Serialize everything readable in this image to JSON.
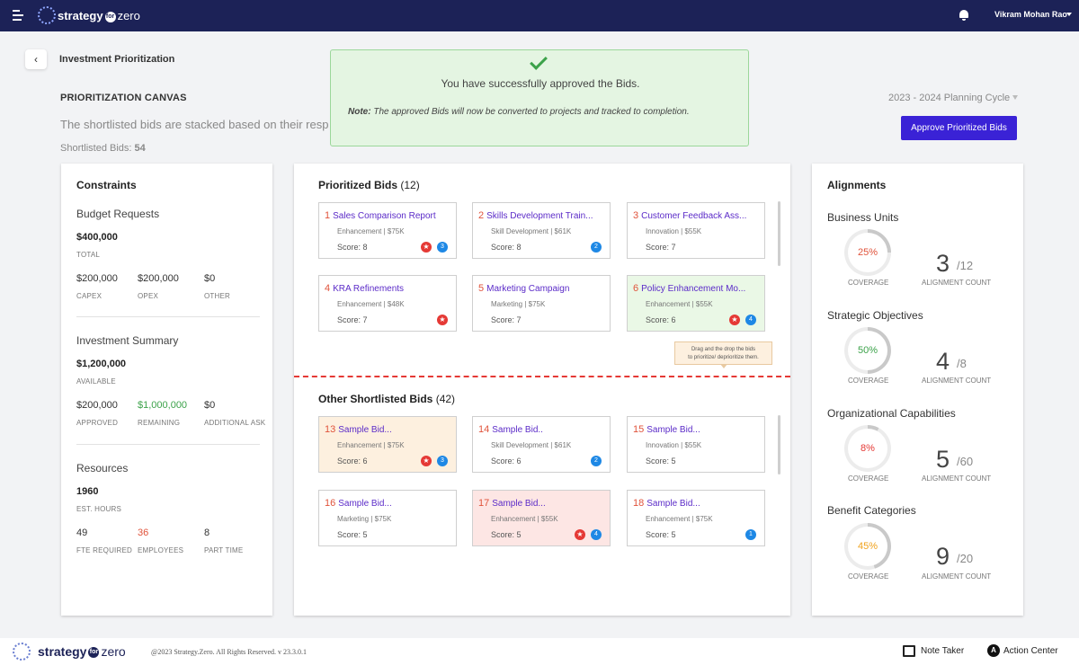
{
  "app": {
    "brand": "strategy",
    "brand_mid": "for",
    "brand_suffix": "zero"
  },
  "user": {
    "name": "Vikram Mohan Rao"
  },
  "header": {
    "back_glyph": "‹",
    "title": "Investment Prioritization",
    "section": "PRIORITIZATION CANVAS",
    "description": "The shortlisted bids are stacked based on their resp",
    "shortlisted_label": "Shortlisted Bids:",
    "shortlisted_count": "54",
    "cycle": "2023 - 2024 Planning Cycle",
    "approve_label": "Approve Prioritized Bids"
  },
  "toast": {
    "message": "You have successfully approved the Bids.",
    "note_label": "Note:",
    "note_text": "The approved Bids will now be converted to projects and tracked to completion."
  },
  "constraints": {
    "title": "Constraints",
    "budget": {
      "title": "Budget Requests",
      "total": "$400,000",
      "total_label": "TOTAL",
      "items": [
        {
          "value": "$200,000",
          "label": "CAPEX"
        },
        {
          "value": "$200,000",
          "label": "OPEX"
        },
        {
          "value": "$0",
          "label": "OTHER"
        }
      ]
    },
    "investment": {
      "title": "Investment Summary",
      "total": "$1,200,000",
      "total_label": "AVAILABLE",
      "items": [
        {
          "value": "$200,000",
          "label": "APPROVED"
        },
        {
          "value": "$1,000,000",
          "label": "REMAINING"
        },
        {
          "value": "$0",
          "label": "ADDITIONAL ASK"
        }
      ]
    },
    "resources": {
      "title": "Resources",
      "total": "1960",
      "total_label": "EST. HOURS",
      "items": [
        {
          "value": "49",
          "label": "FTE REQUIRED"
        },
        {
          "value": "36",
          "label": "EMPLOYEES"
        },
        {
          "value": "8",
          "label": "PART TIME"
        }
      ]
    }
  },
  "prioritized": {
    "title": "Prioritized Bids",
    "count": "(12)",
    "bids": [
      {
        "num": "1",
        "name": "Sales Comparison Report",
        "meta": "Enhancement | $75K",
        "score": "Score: 8",
        "star": true,
        "badge": "3"
      },
      {
        "num": "2",
        "name": "Skills Development Train...",
        "meta": "Skill Development | $61K",
        "score": "Score: 8",
        "star": false,
        "badge": "2"
      },
      {
        "num": "3",
        "name": "Customer Feedback Ass...",
        "meta": "Innovation | $55K",
        "score": "Score: 7",
        "star": false,
        "badge": ""
      },
      {
        "num": "4",
        "name": "KRA Refinements",
        "meta": "Enhancement | $48K",
        "score": "Score: 7",
        "star": true,
        "badge": ""
      },
      {
        "num": "5",
        "name": "Marketing Campaign",
        "meta": "Marketing | $75K",
        "score": "Score: 7",
        "star": false,
        "badge": ""
      },
      {
        "num": "6",
        "name": "Policy Enhancement Mo...",
        "meta": "Enhancement | $55K",
        "score": "Score: 6",
        "star": true,
        "badge": "4"
      }
    ]
  },
  "tooltip": {
    "line1": "Drag and the drop the bids",
    "line2": "to prioritize/ deprioritize them."
  },
  "other": {
    "title": "Other Shortlisted Bids",
    "count": "(42)",
    "bids": [
      {
        "num": "13",
        "name": "Sample Bid...",
        "meta": "Enhancement | $75K",
        "score": "Score: 6",
        "star": true,
        "badge": "3"
      },
      {
        "num": "14",
        "name": "Sample Bid..",
        "meta": "Skill Development | $61K",
        "score": "Score: 6",
        "star": false,
        "badge": "2"
      },
      {
        "num": "15",
        "name": "Sample Bid...",
        "meta": "Innovation | $55K",
        "score": "Score: 5",
        "star": false,
        "badge": ""
      },
      {
        "num": "16",
        "name": "Sample Bid...",
        "meta": "Marketing | $75K",
        "score": "Score: 5",
        "star": false,
        "badge": ""
      },
      {
        "num": "17",
        "name": "Sample Bid...",
        "meta": "Enhancement | $55K",
        "score": "Score: 5",
        "star": true,
        "badge": "4"
      },
      {
        "num": "18",
        "name": "Sample Bid...",
        "meta": "Enhancement | $75K",
        "score": "Score: 5",
        "star": false,
        "badge": "1"
      }
    ]
  },
  "alignments": {
    "title": "Alignments",
    "coverage_label": "COVERAGE",
    "count_label": "ALIGNMENT COUNT",
    "items": [
      {
        "name": "Business Units",
        "coverage": "25%",
        "coverage_pct": 25,
        "color": "#e0533b",
        "count": "3",
        "total": "/12"
      },
      {
        "name": "Strategic Objectives",
        "coverage": "50%",
        "coverage_pct": 50,
        "color": "#3ca24a",
        "count": "4",
        "total": "/8"
      },
      {
        "name": "Organizational Capabilities",
        "coverage": "8%",
        "coverage_pct": 8,
        "color": "#e53935",
        "count": "5",
        "total": "/60"
      },
      {
        "name": "Benefit Categories",
        "coverage": "45%",
        "coverage_pct": 45,
        "color": "#f0a21c",
        "count": "9",
        "total": "/20"
      }
    ]
  },
  "footer": {
    "copyright": "@2023 Strategy.Zero. All Rights Reserved. v 23.3.0.1",
    "note_taker": "Note Taker",
    "action_center": "Action Center",
    "action_glyph": "A"
  },
  "colors": {
    "navbar": "#1c2257",
    "accent": "#3a22d6",
    "bid_title": "#5b2bc8",
    "bid_number": "#e0533b"
  }
}
